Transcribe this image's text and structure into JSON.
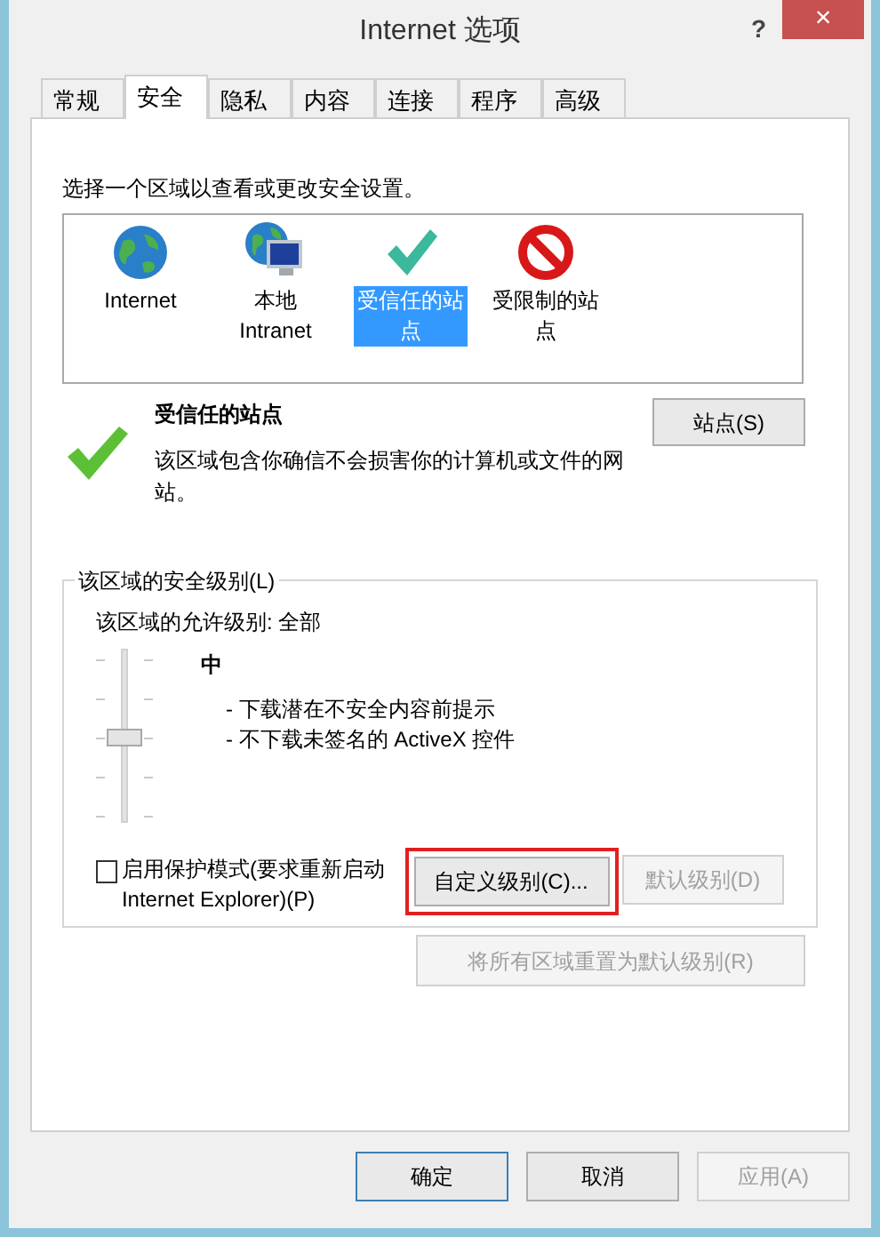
{
  "window": {
    "title": "Internet 选项",
    "help": "?",
    "close": "×"
  },
  "tabs": [
    {
      "label": "常规",
      "selected": false
    },
    {
      "label": "安全",
      "selected": true
    },
    {
      "label": "隐私",
      "selected": false
    },
    {
      "label": "内容",
      "selected": false
    },
    {
      "label": "连接",
      "selected": false
    },
    {
      "label": "程序",
      "selected": false
    },
    {
      "label": "高级",
      "selected": false
    }
  ],
  "zone_prompt": "选择一个区域以查看或更改安全设置。",
  "zones": [
    {
      "kind": "globe",
      "label": "Internet",
      "selected": false
    },
    {
      "kind": "intranet",
      "label": "本地 Intranet",
      "selected": false
    },
    {
      "kind": "trusted",
      "label": "受信任的站点",
      "selected": true
    },
    {
      "kind": "restricted",
      "label": "受限制的站点",
      "selected": false
    }
  ],
  "zone_detail": {
    "title": "受信任的站点",
    "description": "该区域包含你确信不会损害你的计算机或文件的网站。",
    "sites_button": "站点(S)"
  },
  "security_level": {
    "legend": "该区域的安全级别(L)",
    "allowed": "该区域的允许级别: 全部",
    "level": 0.5,
    "level_name": "中",
    "notes": [
      "- 下载潜在不安全内容前提示",
      "- 不下载未签名的 ActiveX 控件"
    ],
    "protected_mode": {
      "label": "启用保护模式(要求重新启动 Internet Explorer)(P)",
      "checked": false
    },
    "custom_button": {
      "label": "自定义级别(C)...",
      "highlighted": true
    },
    "default_button": {
      "label": "默认级别(D)",
      "disabled": true
    }
  },
  "reset_button": {
    "label": "将所有区域重置为默认级别(R)",
    "disabled": true
  },
  "buttons": [
    {
      "label": "确定",
      "disabled": false,
      "selected": true
    },
    {
      "label": "取消",
      "disabled": false,
      "selected": false
    },
    {
      "label": "应用(A)",
      "disabled": true,
      "selected": false
    }
  ]
}
